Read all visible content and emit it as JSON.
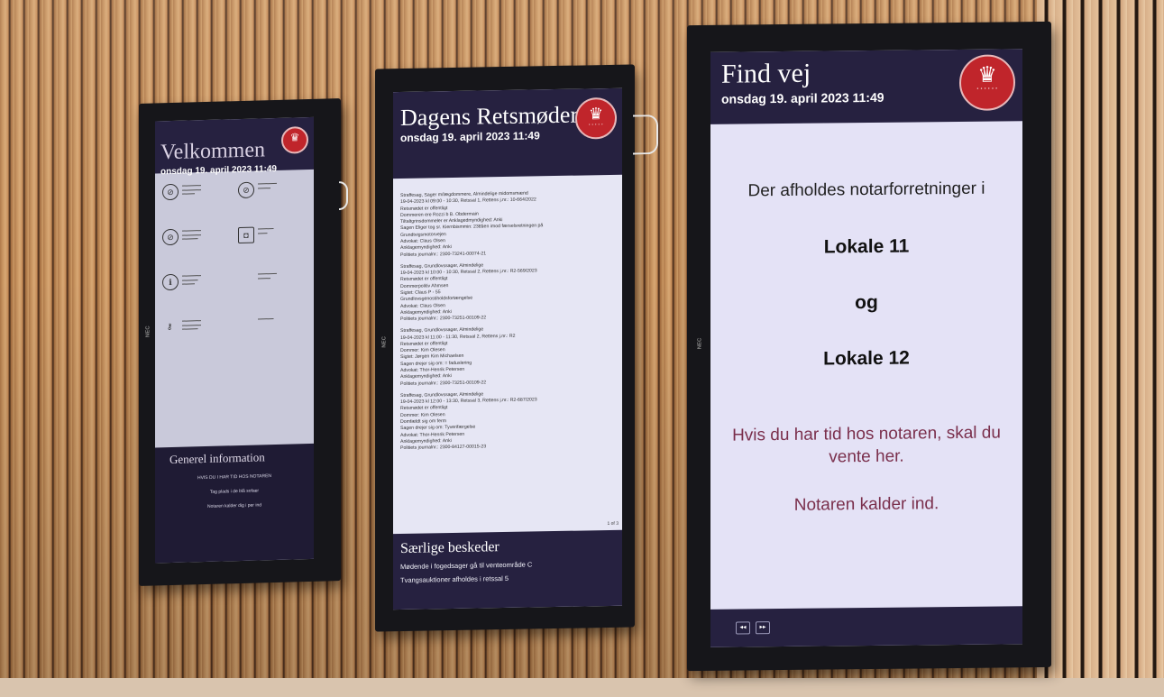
{
  "colors": {
    "header_bg": "#262140",
    "seal_red": "#c0252b",
    "wait_text": "#7a2f4c"
  },
  "monitor_left": {
    "title": "Velkommen",
    "date": "onsdag 19. april 2023 11:49",
    "footer_title": "Generel information",
    "footer_lines": [
      "HVIS DU I HAR TID HOS NOTAREN",
      "Tag plads i de blå sofaer",
      "Notaren kalder dig i per ind"
    ],
    "brand": "NEC",
    "icons": [
      "no-food-icon",
      "no-phone-icon",
      "no-smoking-icon",
      "camera-icon",
      "info-icon",
      "keys-icon"
    ]
  },
  "monitor_middle": {
    "title": "Dagens Retsmøder",
    "date": "onsdag 19. april 2023 11:49",
    "brand": "NEC",
    "page_count": "1 of 3",
    "footer_title": "Særlige beskeder",
    "messages": [
      "Mødende i fogedsager gå til venteområde C",
      "Tvangsauktioner afholdes i retssal 5"
    ],
    "hearings": [
      [
        "Straffesag, Sager m/lægdommere, Almindelige midomsmænd",
        "19-04-2023 kl 09:00 - 10:30, Retssal 1, Rettens j.nr.: 10-664/2022",
        "Retsmødet er offentligt",
        "Dommeren ere Rozzi b B. Obdermain",
        "Tiltaltgrinsdommeler er Anklagedmyndighed: Anki",
        "Sagen Eliger tog sr. Kiernbismmin: 238§en imod færselsretningen på",
        "Grundtvigsmotorvejen",
        "Advokat: Claus Olsen",
        "Anklagemyndighed: Anki",
        "Politiets journalnr.: 2300-73241-00074-21"
      ],
      [
        "Straffesag, Grundlovssager, Almindelige",
        "19-04-2023 kl 10:00 - 10:30, Retssal 2, Rettens j.nr.: R2-569/2023",
        "Retsmødet er offentligt",
        "Dommerpolitiv Ahmsen",
        "Sigtet: Claus P - 55",
        "Grundlovsgenostiholdsfortængelse",
        "Advokat: Claus Olsen",
        "Anklagemyndighed: Anki",
        "Politiets journalnr.: 2300-73251-00109-22"
      ],
      [
        "Straffesag, Grundlovssager, Almindelige",
        "19-04-2023 kl 11:00 - 11:30, Retssal 2, Rettens j.nr.: R2",
        "Retsmødet er offentligt",
        "Dommer: Kim Olesen",
        "Sigtet: Jørgen Kim Michaelsen",
        "Sagen drejer sig om: = faduslering",
        "Advokat: Thor-Henrik Petersen",
        "Anklagemyndighed: Anki",
        "Politiets journalnr.: 2300-73251-00109-22"
      ],
      [
        "Straffesag, Grundlovssager, Almindelige",
        "19-04-2023 kl 12:00 - 13:30, Retssal 3, Rettens j.nr.: R2-687/2023",
        "Retsmødet er offentligt",
        "Dommer: Kim Olesen",
        "Domfældt sig om ferm",
        "Sagen drejer sig om: Tyverifærgelse",
        "Advokat: Thor-Henrik Petersen",
        "Anklagemyndighed: Anki",
        "Politiets journalnr.: 2300-84127-00015-23"
      ]
    ]
  },
  "monitor_right": {
    "title": "Find vej",
    "date": "onsdag 19. april 2023 11:49",
    "brand": "NEC",
    "intro": "Der afholdes notarforretninger i",
    "room_1": "Lokale 11",
    "conjunction": "og",
    "room_2": "Lokale 12",
    "wait_text": "Hvis du har tid hos notaren, skal du vente her.",
    "call_text": "Notaren kalder ind."
  }
}
